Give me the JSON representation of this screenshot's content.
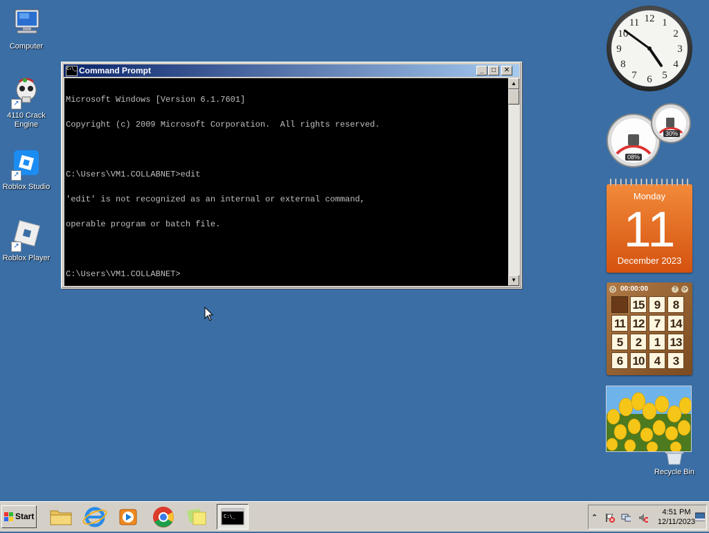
{
  "desktop": {
    "icons": [
      {
        "label": "Computer",
        "icon": "computer-icon"
      },
      {
        "label": "4110 Crack Engine",
        "icon": "skull-icon"
      },
      {
        "label": "Roblox Studio",
        "icon": "roblox-studio-icon"
      },
      {
        "label": "Roblox Player",
        "icon": "roblox-player-icon"
      },
      {
        "label": "Recycle Bin",
        "icon": "recycle-bin-icon"
      }
    ]
  },
  "cmd": {
    "title": "Command Prompt",
    "lines": [
      "Microsoft Windows [Version 6.1.7601]",
      "Copyright (c) 2009 Microsoft Corporation.  All rights reserved.",
      "",
      "C:\\Users\\VM1.COLLABNET>edit",
      "'edit' is not recognized as an internal or external command,",
      "operable program or batch file.",
      "",
      "C:\\Users\\VM1.COLLABNET>"
    ],
    "buttons": {
      "minimize": "_",
      "maximize": "□",
      "close": "✕"
    }
  },
  "gadgets": {
    "clock": {
      "numerals": [
        "12",
        "1",
        "2",
        "3",
        "4",
        "5",
        "6",
        "7",
        "8",
        "9",
        "10",
        "11"
      ],
      "hour": 4,
      "minute": 51
    },
    "meter": {
      "cpu_label": "08%",
      "cpu_value": 8,
      "memory_label": "30%",
      "memory_value": 30
    },
    "calendar": {
      "weekday": "Monday",
      "day": "11",
      "month_year": "December 2023"
    },
    "puzzle": {
      "timer": "00:00:00",
      "tiles": [
        "",
        "15",
        "9",
        "8",
        "11",
        "12",
        "7",
        "14",
        "5",
        "2",
        "1",
        "13",
        "6",
        "10",
        "4",
        "3"
      ]
    },
    "slideshow": {
      "subject": "yellow tulips"
    }
  },
  "taskbar": {
    "start_label": "Start",
    "apps": [
      {
        "name": "explorer",
        "icon": "folder-icon"
      },
      {
        "name": "internet-explorer",
        "icon": "ie-icon"
      },
      {
        "name": "media-player",
        "icon": "media-player-icon"
      },
      {
        "name": "chrome",
        "icon": "chrome-icon"
      },
      {
        "name": "sticky-notes",
        "icon": "sticky-notes-icon"
      },
      {
        "name": "command-prompt",
        "icon": "cmd-icon",
        "active": true
      }
    ],
    "tray": {
      "time": "4:51 PM",
      "date": "12/11/2023",
      "icons": [
        "show-hidden-icon",
        "action-center-icon",
        "network-icon",
        "volume-muted-icon",
        "show-desktop-icon"
      ]
    }
  },
  "colors": {
    "desktop": "#3a6ea5",
    "titlebar_start": "#0a246a",
    "titlebar_end": "#a6caf0",
    "calendar": "#e8661e"
  }
}
